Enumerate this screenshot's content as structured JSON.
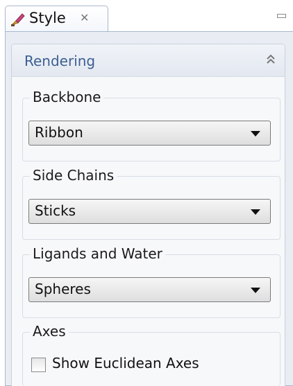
{
  "tab": {
    "title": "Style",
    "icon": "paint-brush-icon",
    "close_icon": "close-icon"
  },
  "view": {
    "minimize_icon": "minimize-icon"
  },
  "section": {
    "title": "Rendering",
    "collapse_icon": "double-chevron-up-icon"
  },
  "groups": {
    "backbone": {
      "label": "Backbone",
      "value": "Ribbon"
    },
    "side_chains": {
      "label": "Side Chains",
      "value": "Sticks"
    },
    "ligands": {
      "label": "Ligands and Water",
      "value": "Spheres"
    },
    "axes": {
      "label": "Axes",
      "checkbox_label": "Show Euclidean Axes",
      "checked": false
    }
  },
  "colors": {
    "section_title": "#3c5f93",
    "panel_bg": "#e9edf3",
    "border": "#a9b8cc"
  }
}
